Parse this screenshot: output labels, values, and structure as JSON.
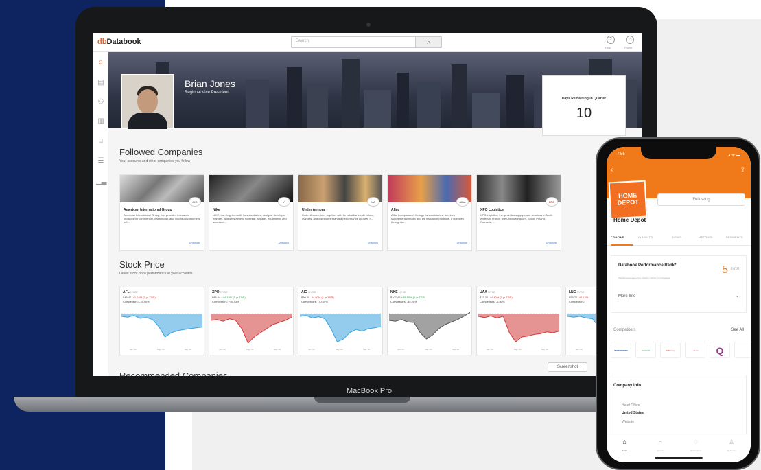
{
  "laptop_label": "MacBook Pro",
  "app": {
    "logo_prefix": "db",
    "logo_text": "Databook",
    "search_placeholder": "Search",
    "topbar_icons": [
      {
        "icon": "help-icon",
        "label": "Help"
      },
      {
        "icon": "user-icon",
        "label": "Profile"
      }
    ],
    "side_nav": [
      {
        "icon": "home-icon",
        "label": "Home",
        "active": true
      },
      {
        "icon": "building-icon",
        "label": "Companies"
      },
      {
        "icon": "people-icon",
        "label": "Contacts"
      },
      {
        "icon": "document-icon",
        "label": "Reports"
      },
      {
        "icon": "org-chart-icon",
        "label": "Accounts"
      },
      {
        "icon": "list-icon",
        "label": "Lists"
      },
      {
        "icon": "bar-chart-icon",
        "label": "Benchmarks"
      }
    ],
    "user": {
      "name": "Brian Jones",
      "role": "Regional Vice President"
    },
    "days_remaining": {
      "label": "Days Remaining in Quarter",
      "value": "10"
    },
    "followed": {
      "title": "Followed Companies",
      "subtitle": "Your accounts and other companies you follow",
      "companies": [
        {
          "name": "American International Group",
          "badge": "AIG",
          "desc": "American International Group, Inc. provides insurance products for commercial, institutional, and individual customers in N...",
          "follow": "Unfollow"
        },
        {
          "name": "Nike",
          "badge": "✓",
          "desc": "NIKE, Inc., together with its subsidiaries, designs, develops, markets, and sells athletic footwear, apparel, equipment, and accessori...",
          "follow": "Unfollow"
        },
        {
          "name": "Under Armour",
          "badge": "UA",
          "desc": "Under Armour, Inc., together with its subsidiaries, develops, markets, and distributes branded performance apparel, f...",
          "follow": "Unfollow"
        },
        {
          "name": "Aflac",
          "badge": "Aflac",
          "desc": "Aflac Incorporated, through its subsidiaries, provides supplemental health and life insurance products. It operates through tw...",
          "follow": "Unfollow"
        },
        {
          "name": "XPO Logistics",
          "badge": "XPO",
          "desc": "XPO Logistics, Inc. provides supply chain solutions in North America, France, the United Kingdom, Spain, Poland, Romania, ...",
          "follow": "Unfollow"
        }
      ]
    },
    "stock": {
      "title": "Stock Price",
      "subtitle": "Latest stock price performance at your accounts",
      "cards": [
        {
          "ticker": "AFL",
          "exchange": "NYSE",
          "price": "$46.47",
          "change": "-41.64% (1 yr TSR)",
          "dir": "down",
          "competitors": "Competitors: -15.40%",
          "color": "#3aa3dd"
        },
        {
          "ticker": "XPO",
          "exchange": "NYSE",
          "price": "$86.04",
          "change": "+44.15% (1 yr TSR)",
          "dir": "up",
          "competitors": "Competitors: +46.43%",
          "color": "#d23a3a"
        },
        {
          "ticker": "AIG",
          "exchange": "NYSE",
          "price": "$30.00",
          "change": "-44.90% (1 yr TSR)",
          "dir": "down",
          "competitors": "Competitors: -70.64%",
          "color": "#3aa3dd"
        },
        {
          "ticker": "NKE",
          "exchange": "NYSE",
          "price": "$107.46",
          "change": "+45.80% (1 yr TSR)",
          "dir": "up",
          "competitors": "Competitors: -45.20%",
          "color": "#555"
        },
        {
          "ticker": "UAA",
          "exchange": "NYSE",
          "price": "$15.26",
          "change": "-44.40% (1 yr TSR)",
          "dir": "down",
          "competitors": "Competitors: -6.80%",
          "color": "#d23a3a"
        },
        {
          "ticker": "LNC",
          "exchange": "NYSE",
          "price": "$55.70",
          "change": "-48.13%",
          "dir": "down",
          "competitors": "Competitors:",
          "color": "#3aa3dd"
        }
      ],
      "x_ticks": [
        "Jan '20",
        "May '20",
        "Sep '20"
      ]
    },
    "screenshot_button": "Screenshot",
    "recommended_title": "Recommended Companies"
  },
  "phone": {
    "time": "7:56",
    "status": "▪ ᯤ ▬",
    "company": "Home Depot",
    "logo_text": "HOME DEPOT",
    "follow_button": "Following",
    "tabs": [
      "PROFILE",
      "INSIGHTS",
      "NEWS",
      "METRICS",
      "SEGMENTS"
    ],
    "rank_label": "Databook Performance Rank*",
    "rank_sub": "Weighted average of key industry metrics vs competitors",
    "rank_value": "5",
    "rank_suffix": "th /10",
    "more_info": "More Info",
    "competitors_label": "Competitors",
    "see_all": "See All",
    "competitors": [
      "WORLD WIDE",
      "menards",
      "JCPenney",
      "Lowe's",
      "Q",
      ""
    ],
    "company_info_label": "Company Info",
    "info": [
      {
        "label": "Head Office",
        "value": "United States"
      },
      {
        "label": "Website",
        "value": ""
      }
    ],
    "nav": [
      {
        "icon": "home-icon",
        "label": "Home",
        "active": true
      },
      {
        "icon": "search-icon",
        "label": "Search"
      },
      {
        "icon": "bell-icon",
        "label": "Notifications"
      },
      {
        "icon": "user-icon",
        "label": "My Profile"
      }
    ]
  }
}
